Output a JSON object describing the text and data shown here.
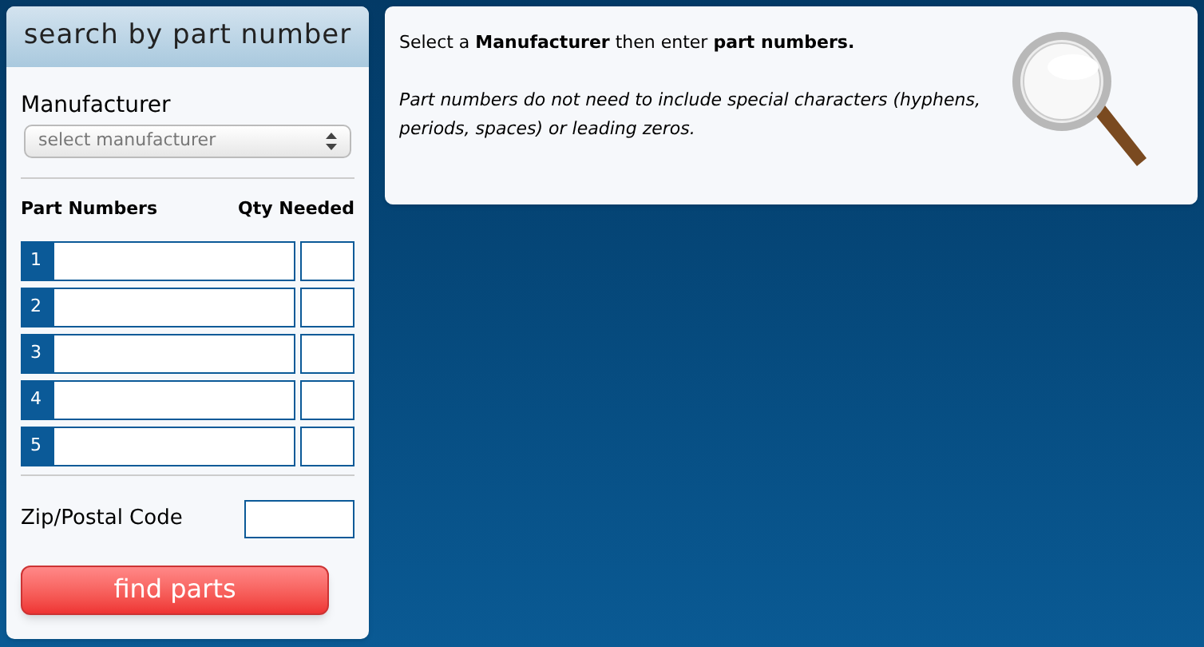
{
  "search_panel": {
    "title": "search by part number",
    "manufacturer_label": "Manufacturer",
    "manufacturer_select": {
      "placeholder": "select manufacturer"
    },
    "columns": [
      "Part Numbers",
      "Qty Needed"
    ],
    "rows": [
      {
        "number": "1"
      },
      {
        "number": "2"
      },
      {
        "number": "3"
      },
      {
        "number": "4"
      },
      {
        "number": "5"
      }
    ],
    "zip_label": "Zip/Postal Code",
    "submit_button": "find parts"
  },
  "info_panel": {
    "instruction": "Select a **Manufacturer** then enter **part numbers.**",
    "note": "Part numbers do not need to include special characters (hyphens, periods, spaces) or leading zeros."
  }
}
